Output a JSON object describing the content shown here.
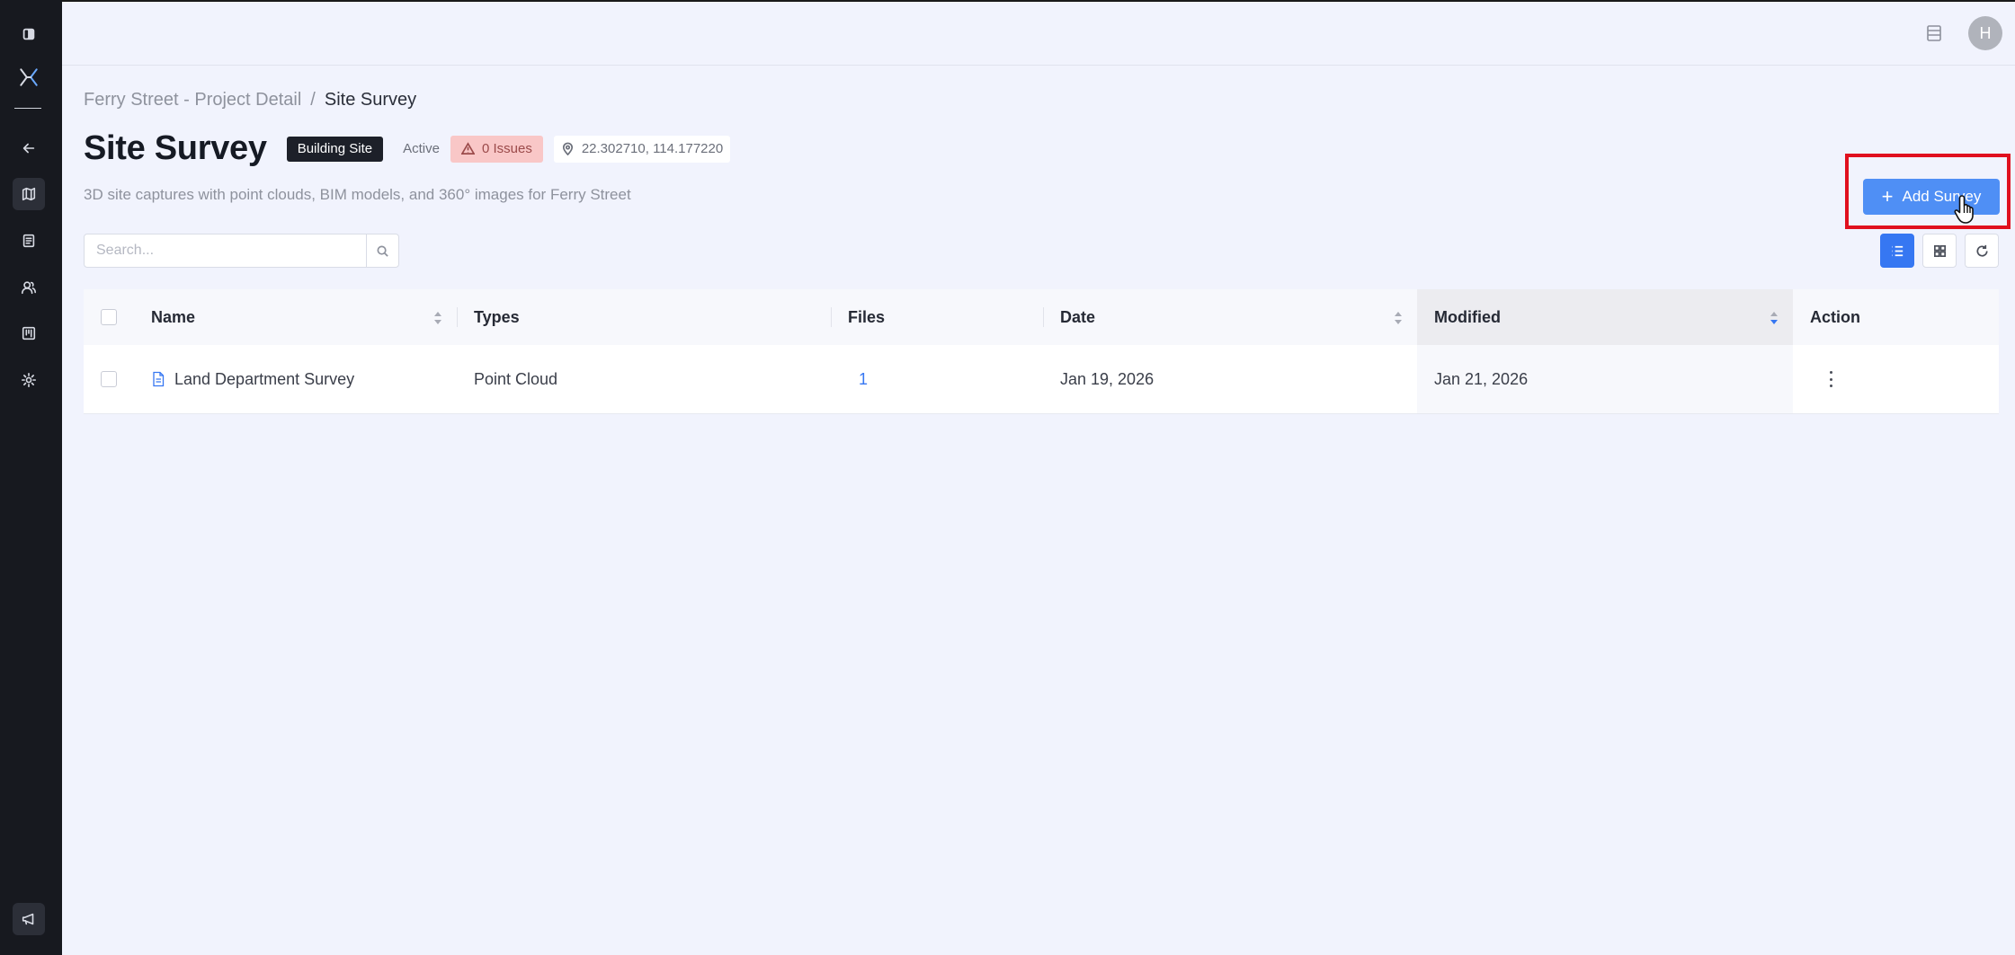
{
  "topbar": {
    "avatar_initial": "H"
  },
  "breadcrumb": {
    "parent": "Ferry Street - Project Detail",
    "separator": "/",
    "current": "Site Survey"
  },
  "header": {
    "title": "Site Survey",
    "category_badge": "Building Site",
    "status": "Active",
    "issues": "0 Issues",
    "coordinates": "22.302710, 114.177220",
    "subtitle": "3D site captures with point clouds, BIM models, and 360° images for Ferry Street"
  },
  "actions": {
    "add_label": "Add Survey"
  },
  "search": {
    "placeholder": "Search..."
  },
  "table": {
    "columns": [
      "Name",
      "Types",
      "Files",
      "Date",
      "Modified",
      "Action"
    ],
    "rows": [
      {
        "name": "Land Department Survey",
        "type": "Point Cloud",
        "files": "1",
        "date": "Jan 19, 2026",
        "modified": "Jan 21, 2026"
      }
    ]
  },
  "colors": {
    "primary": "#3677f2",
    "add_button": "#4f8ff5",
    "sidebar": "#17191f",
    "highlight": "#e0101e",
    "issues_bg": "#f9c7c7"
  }
}
